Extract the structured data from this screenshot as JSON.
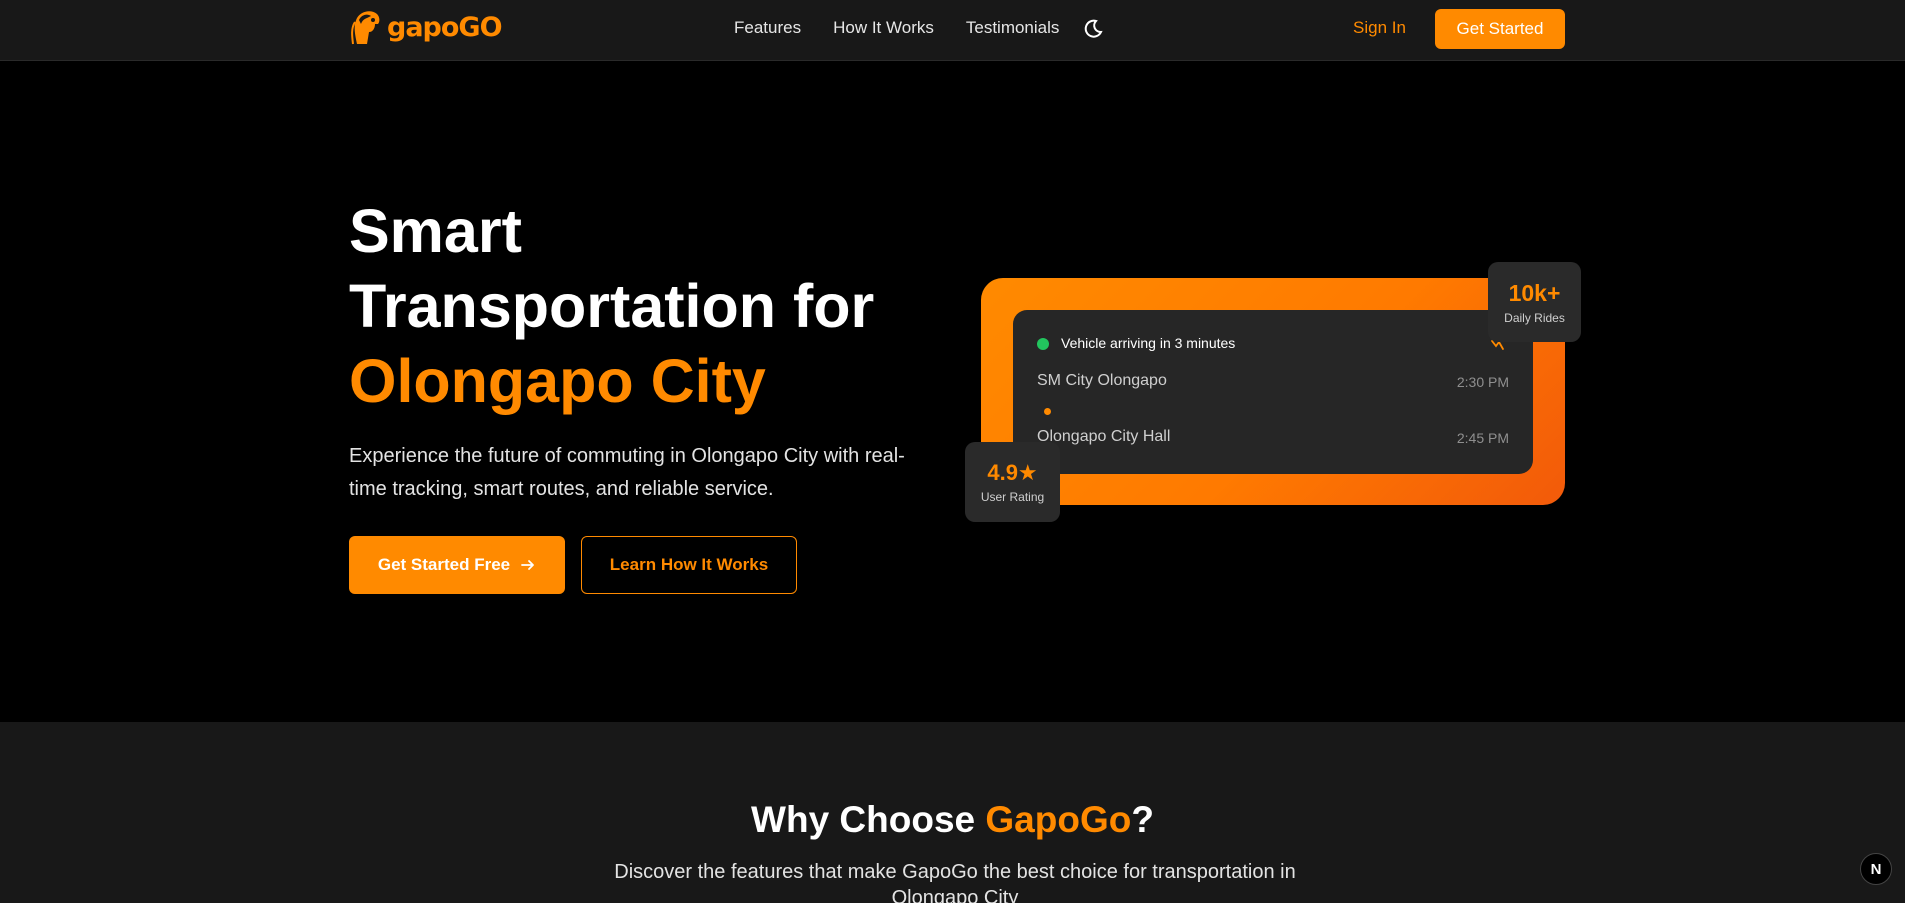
{
  "brand": {
    "name": "gapoGO",
    "accent": "#ff8a00"
  },
  "nav": {
    "links": [
      "Features",
      "How It Works",
      "Testimonials"
    ],
    "sign_in": "Sign In",
    "cta": "Get Started"
  },
  "hero": {
    "title_line1": "Smart",
    "title_line2": "Transportation for",
    "title_accent": "Olongapo City",
    "subtitle": "Experience the future of commuting in Olongapo City with real-time tracking, smart routes, and reliable service.",
    "primary_button": "Get Started Free",
    "secondary_button": "Learn How It Works"
  },
  "ride_card": {
    "status": "Vehicle arriving in 3 minutes",
    "stop_a": "SM City Olongapo",
    "stop_a_time": "2:30 PM",
    "stop_b": "Olongapo City Hall",
    "stop_b_time": "2:45 PM"
  },
  "badges": {
    "rides_value": "10k+",
    "rides_label": "Daily Rides",
    "rating_value": "4.9★",
    "rating_label": "User Rating"
  },
  "why": {
    "title_prefix": "Why Choose ",
    "title_accent": "GapoGo",
    "title_suffix": "?",
    "subtitle": "Discover the features that make GapoGo the best choice for transportation in Olongapo City"
  },
  "dev_badge": "N"
}
